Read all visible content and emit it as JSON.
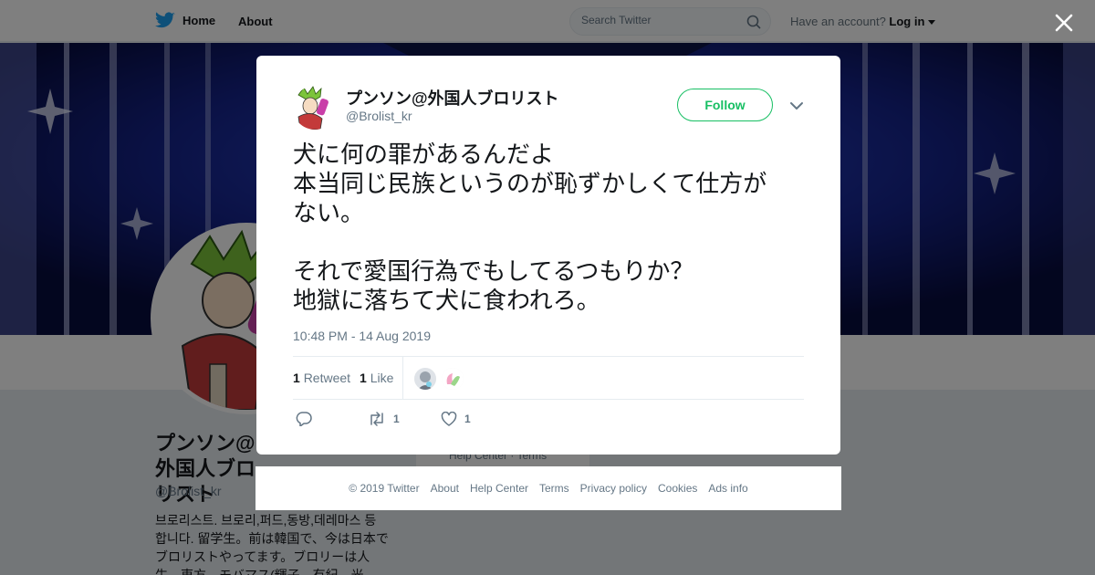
{
  "nav": {
    "home_label": "Home",
    "about_label": "About",
    "search_placeholder": "Search Twitter",
    "account_prompt": "Have an account?",
    "login_label": "Log in"
  },
  "profile": {
    "name": "プンソン@外国人ブロリスト",
    "handle": "@Brolist_kr",
    "bio": "브로리스트. 브로리,퍼드,동방,데레마스 등 합니다. 留学生。前は韓国で、今は日本でブロリストやってます。ブロリーは人生。東方、モバマス(輝子、有紀、光...",
    "footer_help": "Help Center",
    "footer_terms": "Terms"
  },
  "tweet": {
    "author_name": "プンソン@外国人ブロリスト",
    "author_handle": "@Brolist_kr",
    "follow_label": "Follow",
    "lines": [
      "犬に何の罪があるんだよ",
      "本当同じ民族というのが恥ずかしくて仕方が",
      "ない。",
      "",
      "それで愛国行為でもしてるつもりか？",
      "地獄に落ちて犬に食われろ。"
    ],
    "timestamp": "10:48 PM - 14 Aug 2019",
    "retweet_count": "1",
    "retweet_label": "Retweet",
    "like_count": "1",
    "like_label": "Like",
    "action_retweet_count": "1",
    "action_like_count": "1"
  },
  "footer": {
    "copyright": "© 2019 Twitter",
    "links": [
      "About",
      "Help Center",
      "Terms",
      "Privacy policy",
      "Cookies",
      "Ads info"
    ]
  },
  "colors": {
    "follow_green": "#17bf63",
    "twitter_blue": "#1da1f2",
    "muted_text": "#657786",
    "banner_navy": "#0e1a6b"
  },
  "icons": [
    "twitter-bird-icon",
    "search-icon",
    "caret-down-icon",
    "close-icon",
    "chevron-down-icon",
    "reply-icon",
    "retweet-icon",
    "heart-icon"
  ]
}
